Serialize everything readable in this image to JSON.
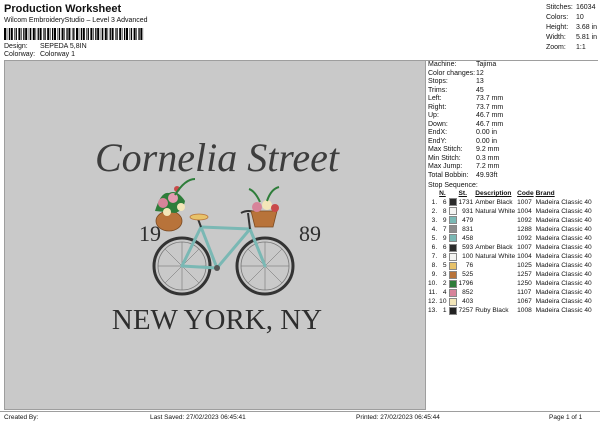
{
  "header": {
    "title": "Production Worksheet",
    "subtitle": "Wilcom EmbroideryStudio – Level 3 Advanced",
    "design_label": "Design:",
    "design_value": "SEPEDA 5,8IN",
    "colorway_label": "Colorway:",
    "colorway_value": "Colorway 1"
  },
  "stats": [
    {
      "k": "Stitches:",
      "v": "16034"
    },
    {
      "k": "Colors:",
      "v": "10"
    },
    {
      "k": "Height:",
      "v": "3.68 in"
    },
    {
      "k": "Width:",
      "v": "5.81 in"
    },
    {
      "k": "Zoom:",
      "v": "1:1"
    }
  ],
  "design": {
    "script_text": "Cornelia Street",
    "year_left": "19",
    "year_right": "89",
    "city": "NEW YORK, NY"
  },
  "machine": [
    {
      "k": "Machine:",
      "v": "Tajima"
    },
    {
      "k": "Color changes:",
      "v": "12"
    },
    {
      "k": "Stops:",
      "v": "13"
    },
    {
      "k": "Trims:",
      "v": "45"
    },
    {
      "k": "Left:",
      "v": "73.7 mm"
    },
    {
      "k": "Right:",
      "v": "73.7 mm"
    },
    {
      "k": "Up:",
      "v": "46.7 mm"
    },
    {
      "k": "Down:",
      "v": "46.7 mm"
    },
    {
      "k": "EndX:",
      "v": "0.00 in"
    },
    {
      "k": "EndY:",
      "v": "0.00 in"
    },
    {
      "k": "Max Stitch:",
      "v": "9.2 mm"
    },
    {
      "k": "Min Stitch:",
      "v": "0.3 mm"
    },
    {
      "k": "Max Jump:",
      "v": "7.2 mm"
    },
    {
      "k": "Total Bobbin:",
      "v": "49.93ft"
    }
  ],
  "stop_sequence": {
    "heading": "Stop Sequence:",
    "columns": [
      "N.",
      "St.",
      "Description",
      "Code",
      "Brand"
    ],
    "rows": [
      {
        "stop": "1.",
        "n": "6",
        "color": "#2b2b2b",
        "st": "1731",
        "desc": "Amber Black",
        "code": "1007",
        "brand": "Madeira Classic 40"
      },
      {
        "stop": "2.",
        "n": "8",
        "color": "#f4f4f2",
        "st": "931",
        "desc": "Natural White",
        "code": "1004",
        "brand": "Madeira Classic 40"
      },
      {
        "stop": "3.",
        "n": "9",
        "color": "#7ab8b4",
        "st": "479",
        "desc": "",
        "code": "1092",
        "brand": "Madeira Classic 40"
      },
      {
        "stop": "4.",
        "n": "7",
        "color": "#8c8c8c",
        "st": "831",
        "desc": "",
        "code": "1288",
        "brand": "Madeira Classic 40"
      },
      {
        "stop": "5.",
        "n": "9",
        "color": "#7ab8b4",
        "st": "458",
        "desc": "",
        "code": "1092",
        "brand": "Madeira Classic 40"
      },
      {
        "stop": "6.",
        "n": "6",
        "color": "#2b2b2b",
        "st": "593",
        "desc": "Amber Black",
        "code": "1007",
        "brand": "Madeira Classic 40"
      },
      {
        "stop": "7.",
        "n": "8",
        "color": "#f4f4f2",
        "st": "100",
        "desc": "Natural White",
        "code": "1004",
        "brand": "Madeira Classic 40"
      },
      {
        "stop": "8.",
        "n": "5",
        "color": "#e7c26a",
        "st": "76",
        "desc": "",
        "code": "1025",
        "brand": "Madeira Classic 40"
      },
      {
        "stop": "9.",
        "n": "3",
        "color": "#b8733a",
        "st": "525",
        "desc": "",
        "code": "1257",
        "brand": "Madeira Classic 40"
      },
      {
        "stop": "10.",
        "n": "2",
        "color": "#2e7d3a",
        "st": "1796",
        "desc": "",
        "code": "1250",
        "brand": "Madeira Classic 40"
      },
      {
        "stop": "11.",
        "n": "4",
        "color": "#d7839a",
        "st": "852",
        "desc": "",
        "code": "1107",
        "brand": "Madeira Classic 40"
      },
      {
        "stop": "12.",
        "n": "10",
        "color": "#f3e6b8",
        "st": "403",
        "desc": "",
        "code": "1067",
        "brand": "Madeira Classic 40"
      },
      {
        "stop": "13.",
        "n": "1",
        "color": "#222222",
        "st": "7257",
        "desc": "Ruby Black",
        "code": "1008",
        "brand": "Madeira Classic 40"
      }
    ]
  },
  "footer": {
    "created_by": "Created By:",
    "last_saved": "Last Saved: 27/02/2023 06:45:41",
    "printed": "Printed: 27/02/2023 06:45:44",
    "page": "Page 1 of 1"
  }
}
